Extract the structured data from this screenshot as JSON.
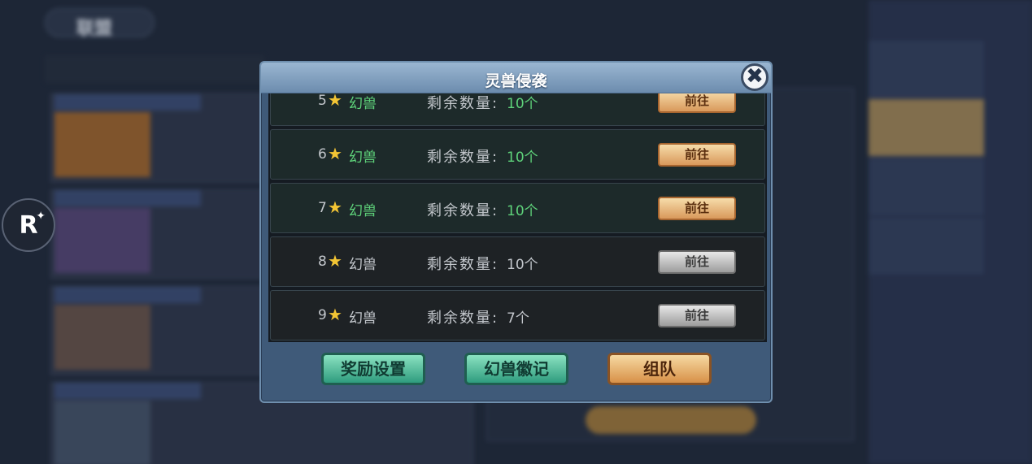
{
  "background": {
    "title": "联盟"
  },
  "badge": {
    "letter": "R",
    "spark": "✦"
  },
  "modal": {
    "title": "灵兽侵袭",
    "close_icon": "✖",
    "remain_label": "剩余数量:",
    "go_label": "前往",
    "rows": [
      {
        "level": "5",
        "star": "★",
        "name": "幻兽",
        "remain": "10个",
        "active": true
      },
      {
        "level": "6",
        "star": "★",
        "name": "幻兽",
        "remain": "10个",
        "active": true
      },
      {
        "level": "7",
        "star": "★",
        "name": "幻兽",
        "remain": "10个",
        "active": true
      },
      {
        "level": "8",
        "star": "★",
        "name": "幻兽",
        "remain": "10个",
        "active": false
      },
      {
        "level": "9",
        "star": "★",
        "name": "幻兽",
        "remain": "7个",
        "active": false
      }
    ],
    "footer": {
      "reward_settings": "奖励设置",
      "beast_badge": "幻兽徽记",
      "team": "组队"
    }
  },
  "colors": {
    "active_text": "#5ed27a",
    "star": "#f3c534",
    "modal_header": "#7f9fc0"
  }
}
